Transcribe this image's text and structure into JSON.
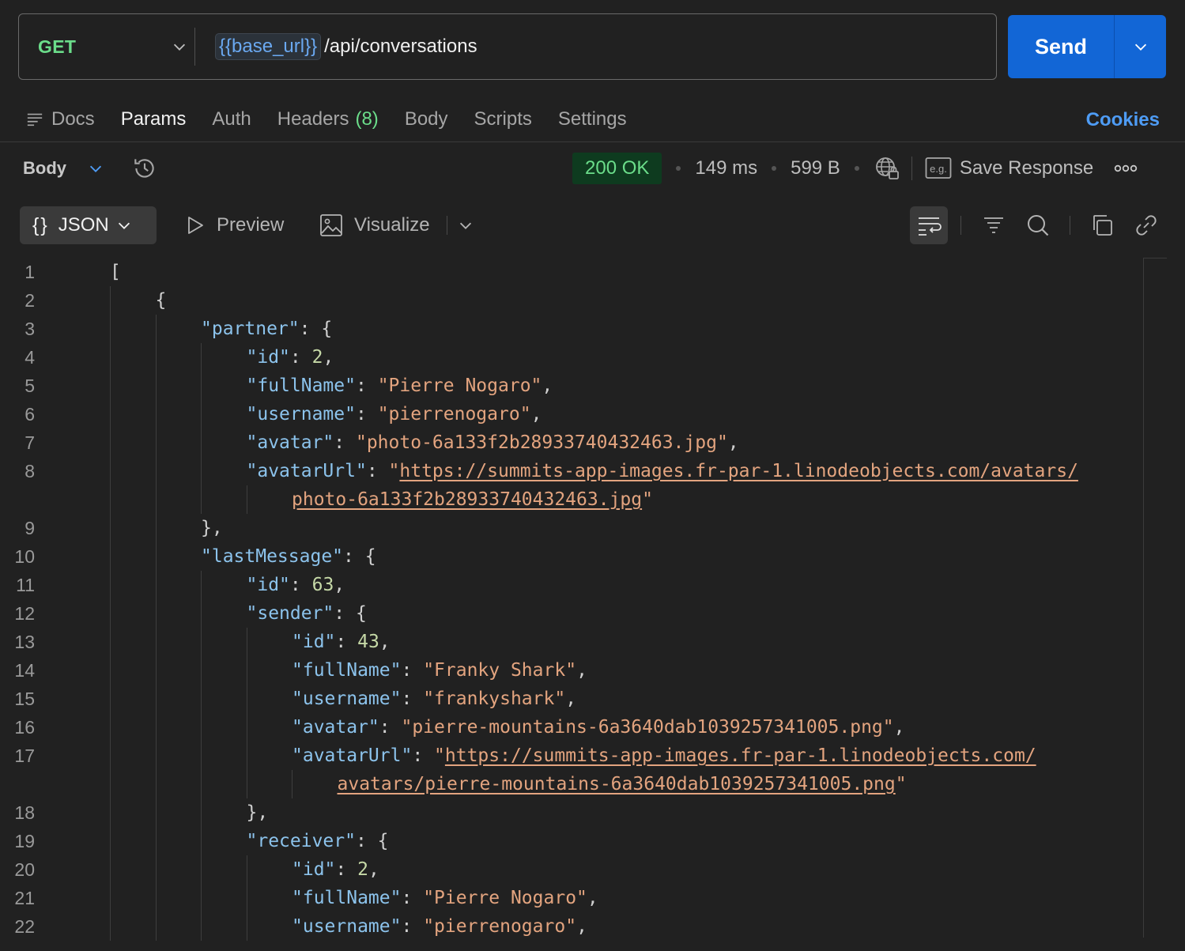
{
  "request": {
    "method": "GET",
    "url_variable": "{{base_url}}",
    "url_path": "/api/conversations",
    "send_label": "Send"
  },
  "tabs": {
    "docs": "Docs",
    "params": "Params",
    "auth": "Auth",
    "headers": "Headers",
    "headers_count": "(8)",
    "body": "Body",
    "scripts": "Scripts",
    "settings": "Settings",
    "cookies": "Cookies"
  },
  "response": {
    "body_label": "Body",
    "status": "200 OK",
    "time": "149 ms",
    "size": "599 B",
    "save_response": "Save Response",
    "format": "JSON",
    "preview": "Preview",
    "visualize": "Visualize"
  },
  "colors": {
    "accent": "#1266d6",
    "method": "#6bdd8a",
    "status_ok": "#6bdd8a",
    "link": "#4e9cf5"
  },
  "icons": [
    "docs-icon",
    "history-icon",
    "globe-lock-icon",
    "example-icon",
    "more-icon",
    "wrap-icon",
    "filter-icon",
    "search-icon",
    "copy-icon",
    "link-icon",
    "preview-icon",
    "visualize-icon"
  ],
  "code": [
    {
      "n": "1",
      "indent": 0,
      "t": [
        [
          "p",
          "["
        ]
      ]
    },
    {
      "n": "2",
      "indent": 1,
      "t": [
        [
          "p",
          "{"
        ]
      ]
    },
    {
      "n": "3",
      "indent": 2,
      "t": [
        [
          "k",
          "\"partner\""
        ],
        [
          "p",
          ": {"
        ]
      ]
    },
    {
      "n": "4",
      "indent": 3,
      "t": [
        [
          "k",
          "\"id\""
        ],
        [
          "p",
          ": "
        ],
        [
          "n",
          "2"
        ],
        [
          "p",
          ","
        ]
      ]
    },
    {
      "n": "5",
      "indent": 3,
      "t": [
        [
          "k",
          "\"fullName\""
        ],
        [
          "p",
          ": "
        ],
        [
          "s",
          "\"Pierre Nogaro\""
        ],
        [
          "p",
          ","
        ]
      ]
    },
    {
      "n": "6",
      "indent": 3,
      "t": [
        [
          "k",
          "\"username\""
        ],
        [
          "p",
          ": "
        ],
        [
          "s",
          "\"pierrenogaro\""
        ],
        [
          "p",
          ","
        ]
      ]
    },
    {
      "n": "7",
      "indent": 3,
      "t": [
        [
          "k",
          "\"avatar\""
        ],
        [
          "p",
          ": "
        ],
        [
          "s",
          "\"photo-6a133f2b28933740432463.jpg\""
        ],
        [
          "p",
          ","
        ]
      ]
    },
    {
      "n": "8",
      "indent": 3,
      "t": [
        [
          "k",
          "\"avatarUrl\""
        ],
        [
          "p",
          ": "
        ],
        [
          "s",
          "\""
        ],
        [
          "u",
          "https://summits-app-images.fr-par-1.linodeobjects.com/avatars/"
        ]
      ]
    },
    {
      "n": "",
      "indent": 4,
      "guides": 4,
      "t": [
        [
          "u",
          "photo-6a133f2b28933740432463.jpg"
        ],
        [
          "s",
          "\""
        ]
      ]
    },
    {
      "n": "9",
      "indent": 2,
      "t": [
        [
          "p",
          "},"
        ]
      ]
    },
    {
      "n": "10",
      "indent": 2,
      "t": [
        [
          "k",
          "\"lastMessage\""
        ],
        [
          "p",
          ": {"
        ]
      ]
    },
    {
      "n": "11",
      "indent": 3,
      "t": [
        [
          "k",
          "\"id\""
        ],
        [
          "p",
          ": "
        ],
        [
          "n",
          "63"
        ],
        [
          "p",
          ","
        ]
      ]
    },
    {
      "n": "12",
      "indent": 3,
      "t": [
        [
          "k",
          "\"sender\""
        ],
        [
          "p",
          ": {"
        ]
      ]
    },
    {
      "n": "13",
      "indent": 4,
      "t": [
        [
          "k",
          "\"id\""
        ],
        [
          "p",
          ": "
        ],
        [
          "n",
          "43"
        ],
        [
          "p",
          ","
        ]
      ]
    },
    {
      "n": "14",
      "indent": 4,
      "t": [
        [
          "k",
          "\"fullName\""
        ],
        [
          "p",
          ": "
        ],
        [
          "s",
          "\"Franky Shark\""
        ],
        [
          "p",
          ","
        ]
      ]
    },
    {
      "n": "15",
      "indent": 4,
      "t": [
        [
          "k",
          "\"username\""
        ],
        [
          "p",
          ": "
        ],
        [
          "s",
          "\"frankyshark\""
        ],
        [
          "p",
          ","
        ]
      ]
    },
    {
      "n": "16",
      "indent": 4,
      "t": [
        [
          "k",
          "\"avatar\""
        ],
        [
          "p",
          ": "
        ],
        [
          "s",
          "\"pierre-mountains-6a3640dab1039257341005.png\""
        ],
        [
          "p",
          ","
        ]
      ]
    },
    {
      "n": "17",
      "indent": 4,
      "t": [
        [
          "k",
          "\"avatarUrl\""
        ],
        [
          "p",
          ": "
        ],
        [
          "s",
          "\""
        ],
        [
          "u",
          "https://summits-app-images.fr-par-1.linodeobjects.com/"
        ]
      ]
    },
    {
      "n": "",
      "indent": 5,
      "guides": 5,
      "t": [
        [
          "u",
          "avatars/pierre-mountains-6a3640dab1039257341005.png"
        ],
        [
          "s",
          "\""
        ]
      ]
    },
    {
      "n": "18",
      "indent": 3,
      "t": [
        [
          "p",
          "},"
        ]
      ]
    },
    {
      "n": "19",
      "indent": 3,
      "t": [
        [
          "k",
          "\"receiver\""
        ],
        [
          "p",
          ": {"
        ]
      ]
    },
    {
      "n": "20",
      "indent": 4,
      "t": [
        [
          "k",
          "\"id\""
        ],
        [
          "p",
          ": "
        ],
        [
          "n",
          "2"
        ],
        [
          "p",
          ","
        ]
      ]
    },
    {
      "n": "21",
      "indent": 4,
      "t": [
        [
          "k",
          "\"fullName\""
        ],
        [
          "p",
          ": "
        ],
        [
          "s",
          "\"Pierre Nogaro\""
        ],
        [
          "p",
          ","
        ]
      ]
    },
    {
      "n": "22",
      "indent": 4,
      "t": [
        [
          "k",
          "\"username\""
        ],
        [
          "p",
          ": "
        ],
        [
          "s",
          "\"pierrenogaro\""
        ],
        [
          "p",
          ","
        ]
      ]
    }
  ]
}
